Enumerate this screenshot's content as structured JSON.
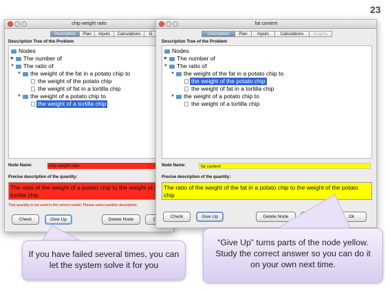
{
  "slide_number": "23",
  "window_left": {
    "title": "chip weight ratio",
    "tabs": [
      {
        "label": "Description",
        "active": true
      },
      {
        "label": "Plan"
      },
      {
        "label": "Inputs"
      },
      {
        "label": "Calculations"
      },
      {
        "label": "G"
      }
    ],
    "tree_label": "Description Tree of the Problem",
    "tree": [
      {
        "text": "Nodes"
      },
      {
        "text": "The number of"
      },
      {
        "text": "The ratio of"
      },
      {
        "text": "the weight of the fat in a potato chip to"
      },
      {
        "text": "the weight of the potato chip"
      },
      {
        "text": "the weight of fat in a tortilla chip"
      },
      {
        "text": "the weight of a potato chip to"
      },
      {
        "text": "the weight of a tortilla chip",
        "selected": true
      }
    ],
    "node_name_label": "Node Name:",
    "node_name_value": "chip weight ratio",
    "node_name_color": "#ff2a1a",
    "precise_label": "Precise description of the quantity:",
    "precise_text": "The ratio of the weight of a potato chip to the weight of a tortilla chip",
    "precise_color": "#ff2a1a",
    "error_message": "That quantity is not used in the correct model. Please select another description.",
    "buttons": {
      "check": "Check",
      "give_up": "Give Up",
      "delete_node": "Delete Node",
      "cancel": "Cancel"
    }
  },
  "window_right": {
    "title": "fat content",
    "tabs": [
      {
        "label": "Description",
        "active": true
      },
      {
        "label": "Plan"
      },
      {
        "label": "Inputs"
      },
      {
        "label": "Calculations"
      },
      {
        "label": "Graphs",
        "disabled": true
      }
    ],
    "tree_label": "Description Tree of the Problem",
    "tree": [
      {
        "text": "Nodes"
      },
      {
        "text": "The number of"
      },
      {
        "text": "The ratio of"
      },
      {
        "text": "the weight of the fat in a potato chip to"
      },
      {
        "text": "the weight of the potato chip",
        "selected": true
      },
      {
        "text": "the weight of fat in a tortilla chip"
      },
      {
        "text": "the weight of a potato chip to"
      },
      {
        "text": "the weight of a tortilla chip"
      }
    ],
    "node_name_label": "Node Name:",
    "node_name_value": "fat content",
    "node_name_color": "#ffff00",
    "precise_label": "Precise description of the quantity:",
    "precise_text": "The ratio of the weight of the fat in a potato chip to the weight of the potato chip",
    "precise_color": "#ffff00",
    "buttons": {
      "check": "Check",
      "give_up": "Give Up",
      "delete_node": "Delete Node",
      "cancel": "Ca",
      "ok": "Ok"
    }
  },
  "callout_left": "If you have failed several times, you can let the system solve it for you",
  "callout_right": "“Give Up” turns parts of the node yellow.  Study the correct answer so you can do it on your own next time.",
  "colors": {
    "selection": "#2f63d8",
    "error": "#d00000",
    "callout": "#e6ddf6"
  }
}
